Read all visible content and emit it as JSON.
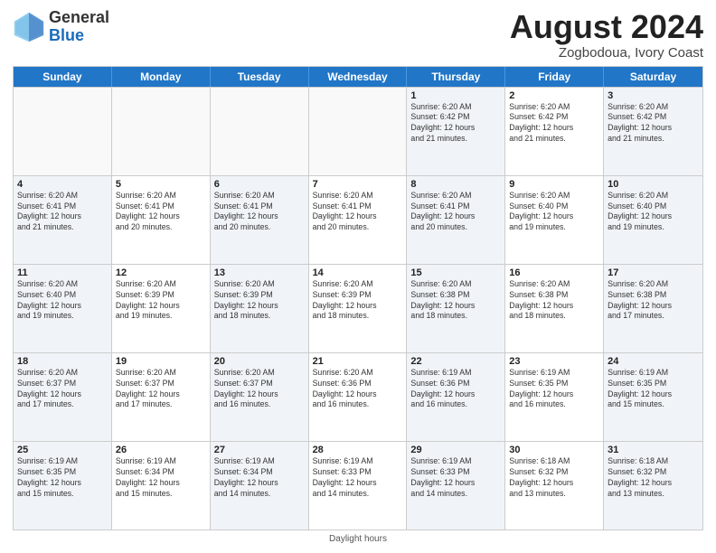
{
  "header": {
    "logo_general": "General",
    "logo_blue": "Blue",
    "month_year": "August 2024",
    "location": "Zogbodoua, Ivory Coast"
  },
  "days_of_week": [
    "Sunday",
    "Monday",
    "Tuesday",
    "Wednesday",
    "Thursday",
    "Friday",
    "Saturday"
  ],
  "weeks": [
    [
      {
        "day": "",
        "info": "",
        "empty": true
      },
      {
        "day": "",
        "info": "",
        "empty": true
      },
      {
        "day": "",
        "info": "",
        "empty": true
      },
      {
        "day": "",
        "info": "",
        "empty": true
      },
      {
        "day": "1",
        "info": "Sunrise: 6:20 AM\nSunset: 6:42 PM\nDaylight: 12 hours\nand 21 minutes.",
        "empty": false
      },
      {
        "day": "2",
        "info": "Sunrise: 6:20 AM\nSunset: 6:42 PM\nDaylight: 12 hours\nand 21 minutes.",
        "empty": false
      },
      {
        "day": "3",
        "info": "Sunrise: 6:20 AM\nSunset: 6:42 PM\nDaylight: 12 hours\nand 21 minutes.",
        "empty": false
      }
    ],
    [
      {
        "day": "4",
        "info": "Sunrise: 6:20 AM\nSunset: 6:41 PM\nDaylight: 12 hours\nand 21 minutes.",
        "empty": false
      },
      {
        "day": "5",
        "info": "Sunrise: 6:20 AM\nSunset: 6:41 PM\nDaylight: 12 hours\nand 20 minutes.",
        "empty": false
      },
      {
        "day": "6",
        "info": "Sunrise: 6:20 AM\nSunset: 6:41 PM\nDaylight: 12 hours\nand 20 minutes.",
        "empty": false
      },
      {
        "day": "7",
        "info": "Sunrise: 6:20 AM\nSunset: 6:41 PM\nDaylight: 12 hours\nand 20 minutes.",
        "empty": false
      },
      {
        "day": "8",
        "info": "Sunrise: 6:20 AM\nSunset: 6:41 PM\nDaylight: 12 hours\nand 20 minutes.",
        "empty": false
      },
      {
        "day": "9",
        "info": "Sunrise: 6:20 AM\nSunset: 6:40 PM\nDaylight: 12 hours\nand 19 minutes.",
        "empty": false
      },
      {
        "day": "10",
        "info": "Sunrise: 6:20 AM\nSunset: 6:40 PM\nDaylight: 12 hours\nand 19 minutes.",
        "empty": false
      }
    ],
    [
      {
        "day": "11",
        "info": "Sunrise: 6:20 AM\nSunset: 6:40 PM\nDaylight: 12 hours\nand 19 minutes.",
        "empty": false
      },
      {
        "day": "12",
        "info": "Sunrise: 6:20 AM\nSunset: 6:39 PM\nDaylight: 12 hours\nand 19 minutes.",
        "empty": false
      },
      {
        "day": "13",
        "info": "Sunrise: 6:20 AM\nSunset: 6:39 PM\nDaylight: 12 hours\nand 18 minutes.",
        "empty": false
      },
      {
        "day": "14",
        "info": "Sunrise: 6:20 AM\nSunset: 6:39 PM\nDaylight: 12 hours\nand 18 minutes.",
        "empty": false
      },
      {
        "day": "15",
        "info": "Sunrise: 6:20 AM\nSunset: 6:38 PM\nDaylight: 12 hours\nand 18 minutes.",
        "empty": false
      },
      {
        "day": "16",
        "info": "Sunrise: 6:20 AM\nSunset: 6:38 PM\nDaylight: 12 hours\nand 18 minutes.",
        "empty": false
      },
      {
        "day": "17",
        "info": "Sunrise: 6:20 AM\nSunset: 6:38 PM\nDaylight: 12 hours\nand 17 minutes.",
        "empty": false
      }
    ],
    [
      {
        "day": "18",
        "info": "Sunrise: 6:20 AM\nSunset: 6:37 PM\nDaylight: 12 hours\nand 17 minutes.",
        "empty": false
      },
      {
        "day": "19",
        "info": "Sunrise: 6:20 AM\nSunset: 6:37 PM\nDaylight: 12 hours\nand 17 minutes.",
        "empty": false
      },
      {
        "day": "20",
        "info": "Sunrise: 6:20 AM\nSunset: 6:37 PM\nDaylight: 12 hours\nand 16 minutes.",
        "empty": false
      },
      {
        "day": "21",
        "info": "Sunrise: 6:20 AM\nSunset: 6:36 PM\nDaylight: 12 hours\nand 16 minutes.",
        "empty": false
      },
      {
        "day": "22",
        "info": "Sunrise: 6:19 AM\nSunset: 6:36 PM\nDaylight: 12 hours\nand 16 minutes.",
        "empty": false
      },
      {
        "day": "23",
        "info": "Sunrise: 6:19 AM\nSunset: 6:35 PM\nDaylight: 12 hours\nand 16 minutes.",
        "empty": false
      },
      {
        "day": "24",
        "info": "Sunrise: 6:19 AM\nSunset: 6:35 PM\nDaylight: 12 hours\nand 15 minutes.",
        "empty": false
      }
    ],
    [
      {
        "day": "25",
        "info": "Sunrise: 6:19 AM\nSunset: 6:35 PM\nDaylight: 12 hours\nand 15 minutes.",
        "empty": false
      },
      {
        "day": "26",
        "info": "Sunrise: 6:19 AM\nSunset: 6:34 PM\nDaylight: 12 hours\nand 15 minutes.",
        "empty": false
      },
      {
        "day": "27",
        "info": "Sunrise: 6:19 AM\nSunset: 6:34 PM\nDaylight: 12 hours\nand 14 minutes.",
        "empty": false
      },
      {
        "day": "28",
        "info": "Sunrise: 6:19 AM\nSunset: 6:33 PM\nDaylight: 12 hours\nand 14 minutes.",
        "empty": false
      },
      {
        "day": "29",
        "info": "Sunrise: 6:19 AM\nSunset: 6:33 PM\nDaylight: 12 hours\nand 14 minutes.",
        "empty": false
      },
      {
        "day": "30",
        "info": "Sunrise: 6:18 AM\nSunset: 6:32 PM\nDaylight: 12 hours\nand 13 minutes.",
        "empty": false
      },
      {
        "day": "31",
        "info": "Sunrise: 6:18 AM\nSunset: 6:32 PM\nDaylight: 12 hours\nand 13 minutes.",
        "empty": false
      }
    ]
  ],
  "footer": "Daylight hours"
}
